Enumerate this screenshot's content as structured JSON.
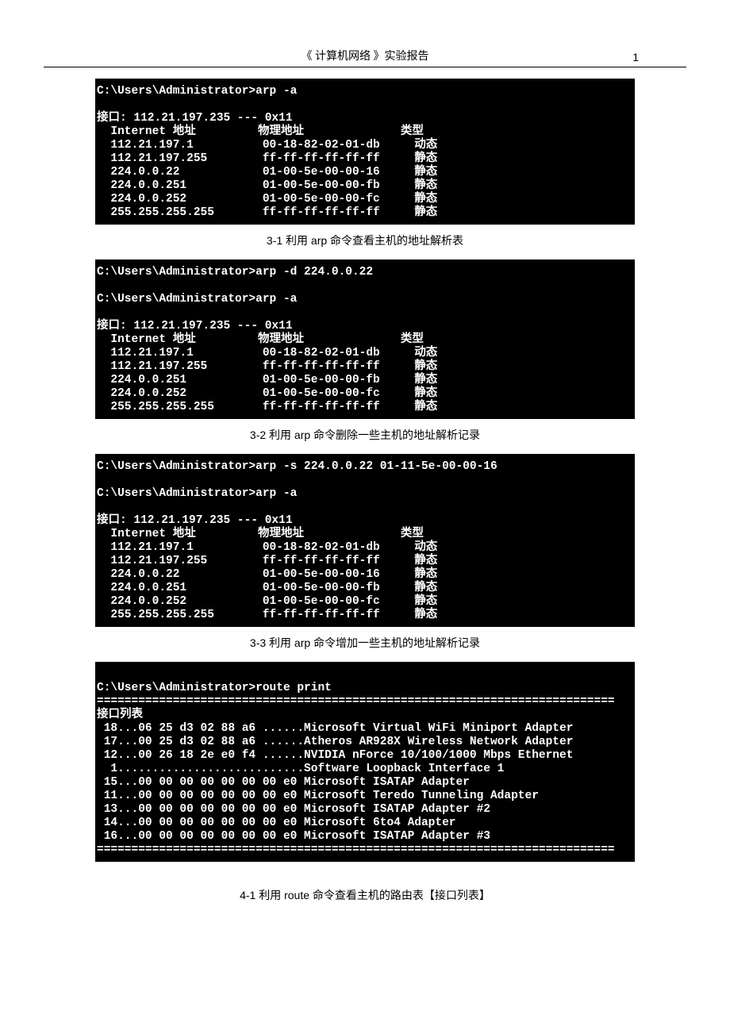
{
  "header": {
    "title": "《  计算机网络  》实验报告",
    "page_number": "1"
  },
  "sections": [
    {
      "terminal": "C:\\Users\\Administrator>arp -a\n\n接口: 112.21.197.235 --- 0x11\n  Internet 地址         物理地址              类型\n  112.21.197.1          00-18-82-02-01-db     动态\n  112.21.197.255        ff-ff-ff-ff-ff-ff     静态\n  224.0.0.22            01-00-5e-00-00-16     静态\n  224.0.0.251           01-00-5e-00-00-fb     静态\n  224.0.0.252           01-00-5e-00-00-fc     静态\n  255.255.255.255       ff-ff-ff-ff-ff-ff     静态\n",
      "caption": "3-1  利用  arp  命令查看主机的地址解析表"
    },
    {
      "terminal": "C:\\Users\\Administrator>arp -d 224.0.0.22\n\nC:\\Users\\Administrator>arp -a\n\n接口: 112.21.197.235 --- 0x11\n  Internet 地址         物理地址              类型\n  112.21.197.1          00-18-82-02-01-db     动态\n  112.21.197.255        ff-ff-ff-ff-ff-ff     静态\n  224.0.0.251           01-00-5e-00-00-fb     静态\n  224.0.0.252           01-00-5e-00-00-fc     静态\n  255.255.255.255       ff-ff-ff-ff-ff-ff     静态",
      "caption": "3-2  利用  arp  命令删除一些主机的地址解析记录"
    },
    {
      "terminal": "C:\\Users\\Administrator>arp -s 224.0.0.22 01-11-5e-00-00-16\n\nC:\\Users\\Administrator>arp -a\n\n接口: 112.21.197.235 --- 0x11\n  Internet 地址         物理地址              类型\n  112.21.197.1          00-18-82-02-01-db     动态\n  112.21.197.255        ff-ff-ff-ff-ff-ff     静态\n  224.0.0.22            01-00-5e-00-00-16     静态\n  224.0.0.251           01-00-5e-00-00-fb     静态\n  224.0.0.252           01-00-5e-00-00-fc     静态\n  255.255.255.255       ff-ff-ff-ff-ff-ff     静态",
      "caption": "3-3  利用  arp  命令增加一些主机的地址解析记录"
    },
    {
      "terminal": "\nC:\\Users\\Administrator>route print\n===========================================================================\n接口列表\n 18...06 25 d3 02 88 a6 ......Microsoft Virtual WiFi Miniport Adapter\n 17...00 25 d3 02 88 a6 ......Atheros AR928X Wireless Network Adapter\n 12...00 26 18 2e e0 f4 ......NVIDIA nForce 10/100/1000 Mbps Ethernet\n  1...........................Software Loopback Interface 1\n 15...00 00 00 00 00 00 00 e0 Microsoft ISATAP Adapter\n 11...00 00 00 00 00 00 00 e0 Microsoft Teredo Tunneling Adapter\n 13...00 00 00 00 00 00 00 e0 Microsoft ISATAP Adapter #2\n 14...00 00 00 00 00 00 00 e0 Microsoft 6to4 Adapter\n 16...00 00 00 00 00 00 00 e0 Microsoft ISATAP Adapter #3\n===========================================================================\n",
      "caption": "4-1 利用  route 命令查看主机的路由表【接口列表】"
    }
  ]
}
